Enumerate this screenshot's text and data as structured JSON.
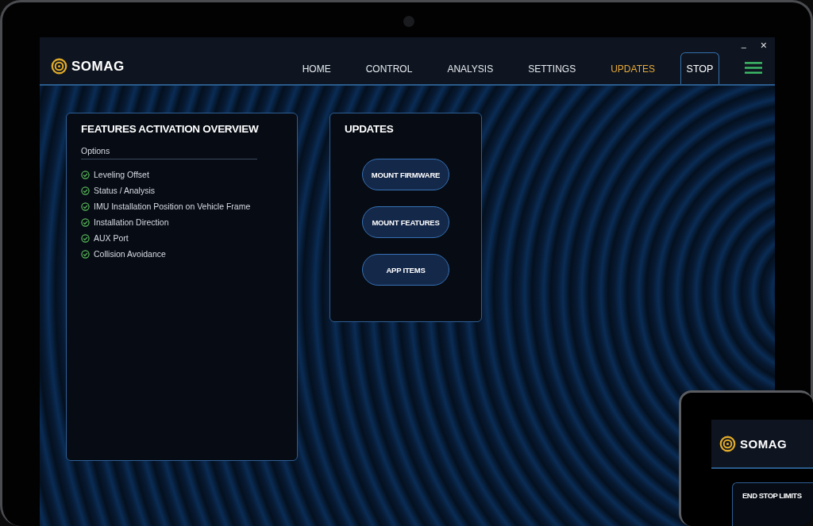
{
  "window_controls": [
    {
      "kind": "minimize",
      "glyph": "–"
    },
    {
      "kind": "close",
      "glyph": "×"
    }
  ],
  "header": {
    "logo": "SOMAG",
    "nav": [
      {
        "label": "HOME",
        "selected": false
      },
      {
        "label": "CONTROL",
        "selected": false
      },
      {
        "label": "ANALYSIS",
        "selected": false
      },
      {
        "label": "SETTINGS",
        "selected": false
      },
      {
        "label": "UPDATES",
        "selected": true
      }
    ],
    "stop_button": "STOP"
  },
  "features_panel": {
    "title": "FEATURES ACTIVATION OVERVIEW",
    "subtitle": "Options",
    "items": [
      {
        "label": "Leveling Offset",
        "checked": true
      },
      {
        "label": "Status / Analysis",
        "checked": true
      },
      {
        "label": "IMU Installation Position on Vehicle Frame",
        "checked": true
      },
      {
        "label": "Installation Direction",
        "checked": true
      },
      {
        "label": "AUX Port",
        "checked": true
      },
      {
        "label": "Collision Avoidance",
        "checked": true
      }
    ]
  },
  "updates_panel": {
    "title": "UPDATES",
    "buttons": [
      "MOUNT FIRMWARE",
      "MOUNT FEATURES",
      "APP ITEMS"
    ]
  },
  "second_device": {
    "logo": "SOMAG",
    "panel_title": "END STOP LIMITS"
  }
}
